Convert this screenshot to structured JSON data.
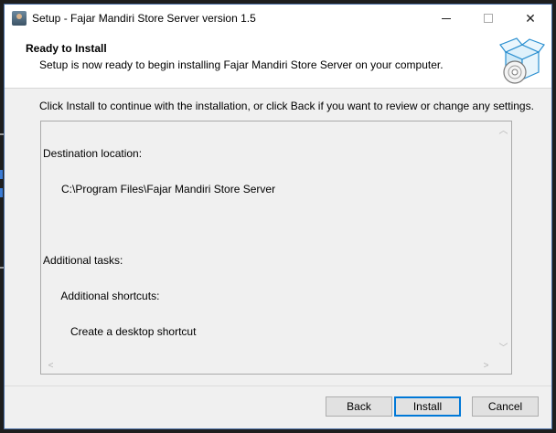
{
  "window": {
    "title": "Setup - Fajar Mandiri Store Server version 1.5",
    "minimize_icon": "minimize-icon",
    "maximize_icon": "maximize-icon",
    "close_glyph": "✕"
  },
  "header": {
    "title": "Ready to Install",
    "subtitle": "Setup is now ready to begin installing Fajar Mandiri Store Server on your computer.",
    "icon": "install-box-icon"
  },
  "instruction": "Click Install to continue with the installation, or click Back if you want to review or change any settings.",
  "memo": {
    "lines": [
      "Destination location:",
      "      C:\\Program Files\\Fajar Mandiri Store Server",
      "",
      "Additional tasks:",
      "      Additional shortcuts:",
      "         Create a desktop shortcut"
    ]
  },
  "buttons": {
    "back": "Back",
    "install": "Install",
    "cancel": "Cancel"
  },
  "colors": {
    "accent": "#0078d7",
    "dialog_bg": "#f0f0f0"
  }
}
